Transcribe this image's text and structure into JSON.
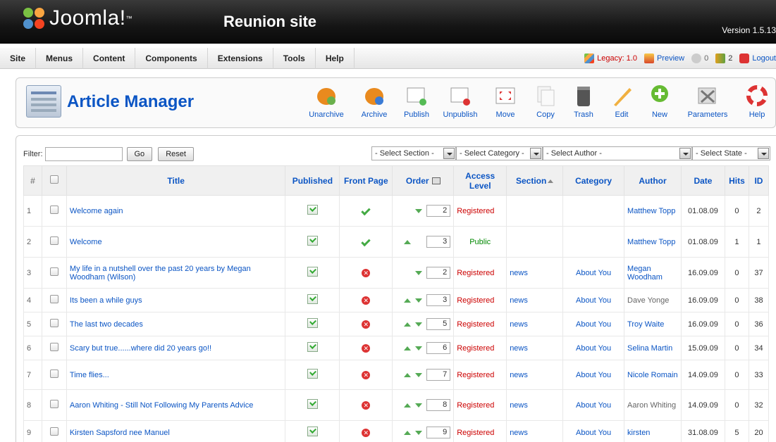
{
  "header": {
    "logo_text": "Joomla!",
    "logo_tm": "™",
    "site_name": "Reunion site",
    "version": "Version 1.5.13"
  },
  "menu": {
    "items": [
      "Site",
      "Menus",
      "Content",
      "Components",
      "Extensions",
      "Tools",
      "Help"
    ]
  },
  "status": {
    "legacy": "Legacy: 1.0",
    "preview": "Preview",
    "messages": "0",
    "users": "2",
    "logout": "Logout"
  },
  "toolbar": {
    "title": "Article Manager",
    "buttons": [
      {
        "label": "Unarchive",
        "icon": "unarchive-icon"
      },
      {
        "label": "Archive",
        "icon": "archive-icon"
      },
      {
        "label": "Publish",
        "icon": "publish-icon"
      },
      {
        "label": "Unpublish",
        "icon": "unpublish-icon"
      },
      {
        "label": "Move",
        "icon": "move-icon"
      },
      {
        "label": "Copy",
        "icon": "copy-icon"
      },
      {
        "label": "Trash",
        "icon": "trash-icon"
      },
      {
        "label": "Edit",
        "icon": "edit-icon"
      },
      {
        "label": "New",
        "icon": "new-icon"
      },
      {
        "label": "Parameters",
        "icon": "parameters-icon"
      },
      {
        "label": "Help",
        "icon": "help-icon"
      }
    ]
  },
  "filter": {
    "label": "Filter:",
    "value": "",
    "go": "Go",
    "reset": "Reset",
    "section": "- Select Section -",
    "category": "- Select Category -",
    "author": "- Select Author -",
    "state": "- Select State -"
  },
  "table": {
    "headers": {
      "num": "#",
      "title": "Title",
      "published": "Published",
      "frontpage": "Front Page",
      "order": "Order",
      "access": "Access Level",
      "section": "Section",
      "category": "Category",
      "author": "Author",
      "date": "Date",
      "hits": "Hits",
      "id": "ID"
    },
    "rows": [
      {
        "num": "1",
        "title": "Welcome again",
        "frontpage": true,
        "up": false,
        "down": true,
        "order": "2",
        "access": "Registered",
        "section": "",
        "category": "",
        "author": "Matthew Topp",
        "date": "01.08.09",
        "hits": "0",
        "id": "2"
      },
      {
        "num": "2",
        "title": "Welcome",
        "frontpage": true,
        "up": true,
        "down": false,
        "order": "3",
        "access": "Public",
        "section": "",
        "category": "",
        "author": "Matthew Topp",
        "date": "01.08.09",
        "hits": "1",
        "id": "1"
      },
      {
        "num": "3",
        "title": "My life in a nutshell over the past 20 years by Megan Woodham (Wilson)",
        "frontpage": false,
        "up": false,
        "down": true,
        "order": "2",
        "access": "Registered",
        "section": "news",
        "category": "About You",
        "author": "Megan Woodham",
        "date": "16.09.09",
        "hits": "0",
        "id": "37"
      },
      {
        "num": "4",
        "title": "Its been a while guys",
        "frontpage": false,
        "up": true,
        "down": true,
        "order": "3",
        "access": "Registered",
        "section": "news",
        "category": "About You",
        "author": "Dave Yonge",
        "date": "16.09.09",
        "hits": "0",
        "id": "38"
      },
      {
        "num": "5",
        "title": "The last two decades",
        "frontpage": false,
        "up": true,
        "down": true,
        "order": "5",
        "access": "Registered",
        "section": "news",
        "category": "About You",
        "author": "Troy Waite",
        "date": "16.09.09",
        "hits": "0",
        "id": "36"
      },
      {
        "num": "6",
        "title": "Scary but true......where did 20 years go!!",
        "frontpage": false,
        "up": true,
        "down": true,
        "order": "6",
        "access": "Registered",
        "section": "news",
        "category": "About You",
        "author": "Selina Martin",
        "date": "15.09.09",
        "hits": "0",
        "id": "34"
      },
      {
        "num": "7",
        "title": "Time flies...",
        "frontpage": false,
        "up": true,
        "down": true,
        "order": "7",
        "access": "Registered",
        "section": "news",
        "category": "About You",
        "author": "Nicole Romain",
        "date": "14.09.09",
        "hits": "0",
        "id": "33"
      },
      {
        "num": "8",
        "title": "Aaron Whiting - Still Not Following My Parents Advice",
        "frontpage": false,
        "up": true,
        "down": true,
        "order": "8",
        "access": "Registered",
        "section": "news",
        "category": "About You",
        "author": "Aaron Whiting",
        "date": "14.09.09",
        "hits": "0",
        "id": "32"
      },
      {
        "num": "9",
        "title": "Kirsten Sapsford nee Manuel",
        "frontpage": false,
        "up": true,
        "down": true,
        "order": "9",
        "access": "Registered",
        "section": "news",
        "category": "About You",
        "author": "kirsten",
        "date": "31.08.09",
        "hits": "5",
        "id": "20"
      }
    ]
  },
  "colors": {
    "link": "#0b55c4",
    "registered": "#cc0000",
    "public": "#008800",
    "header_bg": "#151515"
  }
}
